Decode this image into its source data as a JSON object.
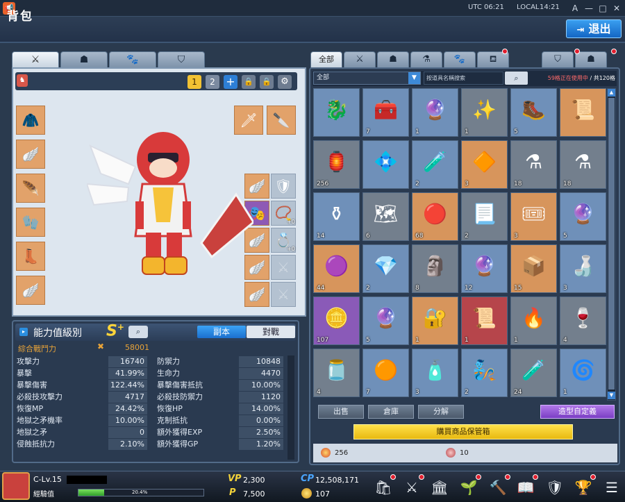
{
  "topbar": {
    "utc_label": "UTC",
    "utc_time": "06:21",
    "local_label": "LOCAL",
    "local_time": "14:21",
    "font_btn": "A",
    "min_btn": "—",
    "max_btn": "□",
    "close_btn": "✕"
  },
  "title": "背包",
  "exit_label": "退出",
  "left_tabs": [
    {
      "icon": "⚔"
    },
    {
      "icon": "☗"
    },
    {
      "icon": "🐾"
    },
    {
      "icon": "⛉"
    }
  ],
  "presets": {
    "p1": "1",
    "p2": "2",
    "add": "+",
    "lock1": "🔒",
    "lock2": "🔒",
    "gear": "⚙"
  },
  "equip_left": [
    "🧥",
    "🪽",
    "🪶",
    "🧤",
    "👢",
    "🪽"
  ],
  "equip_weapon": [
    "🗡",
    "🔪"
  ],
  "equip_right": [
    {
      "icon": "🪽",
      "count": ""
    },
    {
      "icon": "🛡",
      "count": ""
    },
    {
      "icon": "🎭",
      "count": ""
    },
    {
      "icon": "📿",
      "count": "+0"
    },
    {
      "icon": "🪽",
      "count": ""
    },
    {
      "icon": "💍",
      "count": "+0"
    },
    {
      "icon": "🪽",
      "count": ""
    },
    {
      "icon": "⚔",
      "count": ""
    },
    {
      "icon": "🪽",
      "count": ""
    },
    {
      "icon": "⚔",
      "count": ""
    }
  ],
  "stats_title": "能力值級別",
  "grade": "S",
  "grade_plus": "+",
  "mode_pve": "副本",
  "mode_pvp": "對戰",
  "combat_power_label": "綜合戰鬥力",
  "combat_power_value": "58001",
  "stats_left": [
    {
      "label": "攻擊力",
      "value": "16740"
    },
    {
      "label": "暴擊",
      "value": "41.99%"
    },
    {
      "label": "暴擊傷害",
      "value": "122.44%"
    },
    {
      "label": "必殺技攻擊力",
      "value": "4717"
    },
    {
      "label": "恢復MP",
      "value": "24.42%"
    },
    {
      "label": "地獄之矛機率",
      "value": "10.00%"
    },
    {
      "label": "地獄之矛",
      "value": "0"
    },
    {
      "label": "侵蝕抵抗力",
      "value": "2.10%"
    }
  ],
  "stats_right": [
    {
      "label": "防禦力",
      "value": "10848"
    },
    {
      "label": "生命力",
      "value": "4470"
    },
    {
      "label": "暴擊傷害抵抗",
      "value": "10.00%"
    },
    {
      "label": "必殺技防禦力",
      "value": "1120"
    },
    {
      "label": "恢復HP",
      "value": "14.00%"
    },
    {
      "label": "克制抵抗",
      "value": "0.00%"
    },
    {
      "label": "額外獲得EXP",
      "value": "2.50%"
    },
    {
      "label": "額外獲得GP",
      "value": "1.20%"
    }
  ],
  "right_tabs": [
    {
      "label": "全部"
    },
    {
      "label": "⚔"
    },
    {
      "label": "☗"
    },
    {
      "label": "⚗"
    },
    {
      "label": "🐾"
    },
    {
      "label": "⛾"
    },
    {
      "label": "⛉"
    },
    {
      "label": "☗"
    }
  ],
  "filter": {
    "category": "全部",
    "search_placeholder": "按道具名稱搜索",
    "slots_used": "59格正在使用中",
    "slots_total": " / 共120格"
  },
  "inventory": [
    {
      "icon": "🐉",
      "count": "",
      "color": "blue"
    },
    {
      "icon": "🧰",
      "count": "7",
      "color": "blue"
    },
    {
      "icon": "🔮",
      "count": "1",
      "color": "blue"
    },
    {
      "icon": "✨",
      "count": "1",
      "color": "gray"
    },
    {
      "icon": "🥾",
      "count": "5",
      "color": "blue"
    },
    {
      "icon": "📜",
      "count": "",
      "color": "orange"
    },
    {
      "icon": "🏮",
      "count": "256",
      "color": "gray"
    },
    {
      "icon": "💠",
      "count": "",
      "color": "blue"
    },
    {
      "icon": "🧪",
      "count": "2",
      "color": "blue"
    },
    {
      "icon": "🔶",
      "count": "3",
      "color": "orange"
    },
    {
      "icon": "⚗",
      "count": "18",
      "color": "gray"
    },
    {
      "icon": "⚗",
      "count": "18",
      "color": "gray"
    },
    {
      "icon": "⚱",
      "count": "14",
      "color": "blue"
    },
    {
      "icon": "🗺",
      "count": "6",
      "color": "gray"
    },
    {
      "icon": "🔴",
      "count": "68",
      "color": "orange"
    },
    {
      "icon": "📃",
      "count": "2",
      "color": "gray"
    },
    {
      "icon": "🎟",
      "count": "3",
      "color": "orange"
    },
    {
      "icon": "🔮",
      "count": "5",
      "color": "blue"
    },
    {
      "icon": "🟣",
      "count": "44",
      "color": "orange"
    },
    {
      "icon": "💎",
      "count": "2",
      "color": "blue"
    },
    {
      "icon": "🗿",
      "count": "8",
      "color": "gray"
    },
    {
      "icon": "🔮",
      "count": "12",
      "color": "blue"
    },
    {
      "icon": "📦",
      "count": "15",
      "color": "orange"
    },
    {
      "icon": "🍶",
      "count": "3",
      "color": "blue"
    },
    {
      "icon": "🪙",
      "count": "107",
      "color": "purple"
    },
    {
      "icon": "🔮",
      "count": "5",
      "color": "blue"
    },
    {
      "icon": "🔐",
      "count": "1",
      "color": "orange"
    },
    {
      "icon": "📜",
      "count": "1",
      "color": "red"
    },
    {
      "icon": "🔥",
      "count": "1",
      "color": "gray"
    },
    {
      "icon": "🍷",
      "count": "4",
      "color": "gray"
    },
    {
      "icon": "🫙",
      "count": "4",
      "color": "gray"
    },
    {
      "icon": "🟠",
      "count": "7",
      "color": "blue"
    },
    {
      "icon": "🧴",
      "count": "3",
      "color": "blue"
    },
    {
      "icon": "🧞",
      "count": "2",
      "color": "blue"
    },
    {
      "icon": "🧪",
      "count": "24",
      "color": "gray"
    },
    {
      "icon": "🌀",
      "count": "1",
      "color": "blue"
    }
  ],
  "actions": {
    "sell": "出售",
    "storage": "倉庫",
    "disassemble": "分解",
    "custom": "造型自定義",
    "delivery": "購買商品保管箱"
  },
  "currencies": {
    "c1": "256",
    "c2": "10"
  },
  "player": {
    "level": "C-Lv.15",
    "exp_label": "經驗值",
    "exp_pct_text": "20.4%",
    "exp_fraction": 0.204
  },
  "hud": {
    "vp_label": "VP",
    "vp": "2,300",
    "p_label": "P",
    "p": "7,500",
    "cp_label": "CP",
    "cp": "12,508,171",
    "coin": "107"
  },
  "bottom_icons": [
    "🛍",
    "⚔",
    "🏛",
    "🌱",
    "🔨",
    "📖",
    "🛡",
    "🏆",
    "☰"
  ],
  "colors": {
    "accent": "#1b6fce",
    "cp_gold": "#e8a338",
    "delivery": "#ffd533",
    "custom": "#8e4ad6"
  }
}
